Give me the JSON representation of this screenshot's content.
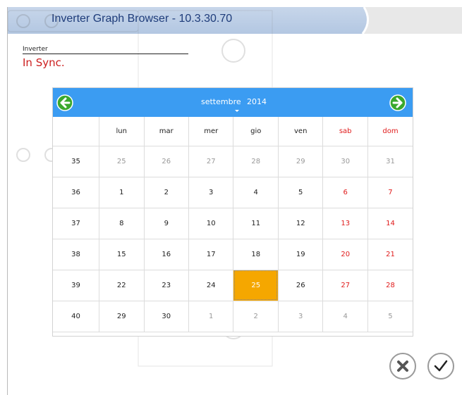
{
  "window": {
    "title": "Inverter Graph Browser - 10.3.30.70"
  },
  "inverter": {
    "label": "Inverter",
    "status": "In Sync."
  },
  "calendar": {
    "month": "settembre",
    "year": "2014",
    "weekdays": [
      "lun",
      "mar",
      "mer",
      "gio",
      "ven",
      "sab",
      "dom"
    ],
    "weeks": [
      {
        "week": "35",
        "days": [
          "25",
          "26",
          "27",
          "28",
          "29",
          "30",
          "31"
        ]
      },
      {
        "week": "36",
        "days": [
          "1",
          "2",
          "3",
          "4",
          "5",
          "6",
          "7"
        ]
      },
      {
        "week": "37",
        "days": [
          "8",
          "9",
          "10",
          "11",
          "12",
          "13",
          "14"
        ]
      },
      {
        "week": "38",
        "days": [
          "15",
          "16",
          "17",
          "18",
          "19",
          "20",
          "21"
        ]
      },
      {
        "week": "39",
        "days": [
          "22",
          "23",
          "24",
          "25",
          "26",
          "27",
          "28"
        ]
      },
      {
        "week": "40",
        "days": [
          "29",
          "30",
          "1",
          "2",
          "3",
          "4",
          "5"
        ]
      }
    ],
    "selected_day": "25",
    "colors": {
      "header": "#3b9cf2",
      "selected": "#f5a700",
      "weekend": "#e01b1b",
      "nav_button": "#3aa82d"
    }
  },
  "icons": {
    "prev": "arrow-left-icon",
    "next": "arrow-right-icon",
    "cancel": "close-icon",
    "confirm": "checkmark-icon"
  }
}
